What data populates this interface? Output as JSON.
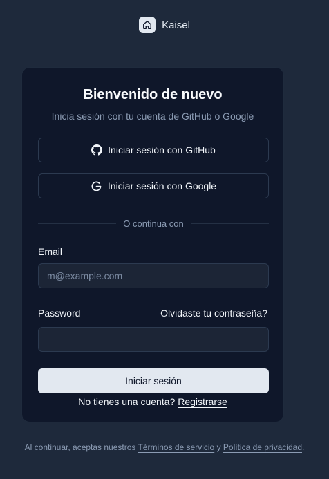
{
  "brand": {
    "name": "Kaisel",
    "logo_icon": "home-icon"
  },
  "card": {
    "title": "Bienvenido de nuevo",
    "subtitle": "Inicia sesión con tu cuenta de GitHub o Google",
    "github_button": "Iniciar sesión con GitHub",
    "google_button": "Iniciar sesión con Google",
    "divider": "O continua con",
    "email_label": "Email",
    "email_placeholder": "m@example.com",
    "email_value": "",
    "password_label": "Password",
    "password_value": "",
    "forgot_link": "Olvidaste tu contraseña?",
    "submit_button": "Iniciar sesión",
    "signup_prompt": "No tienes una cuenta?",
    "signup_link": "Registrarse"
  },
  "footer": {
    "prefix": "Al continuar, aceptas nuestros",
    "terms_link": "Términos de servicio",
    "and": "y",
    "privacy_link": "Política de privacidad",
    "suffix": "."
  },
  "colors": {
    "background": "#1e293b",
    "card": "#0f172a",
    "primary_button": "#e2e8f0",
    "muted_text": "#8b9bb3"
  }
}
